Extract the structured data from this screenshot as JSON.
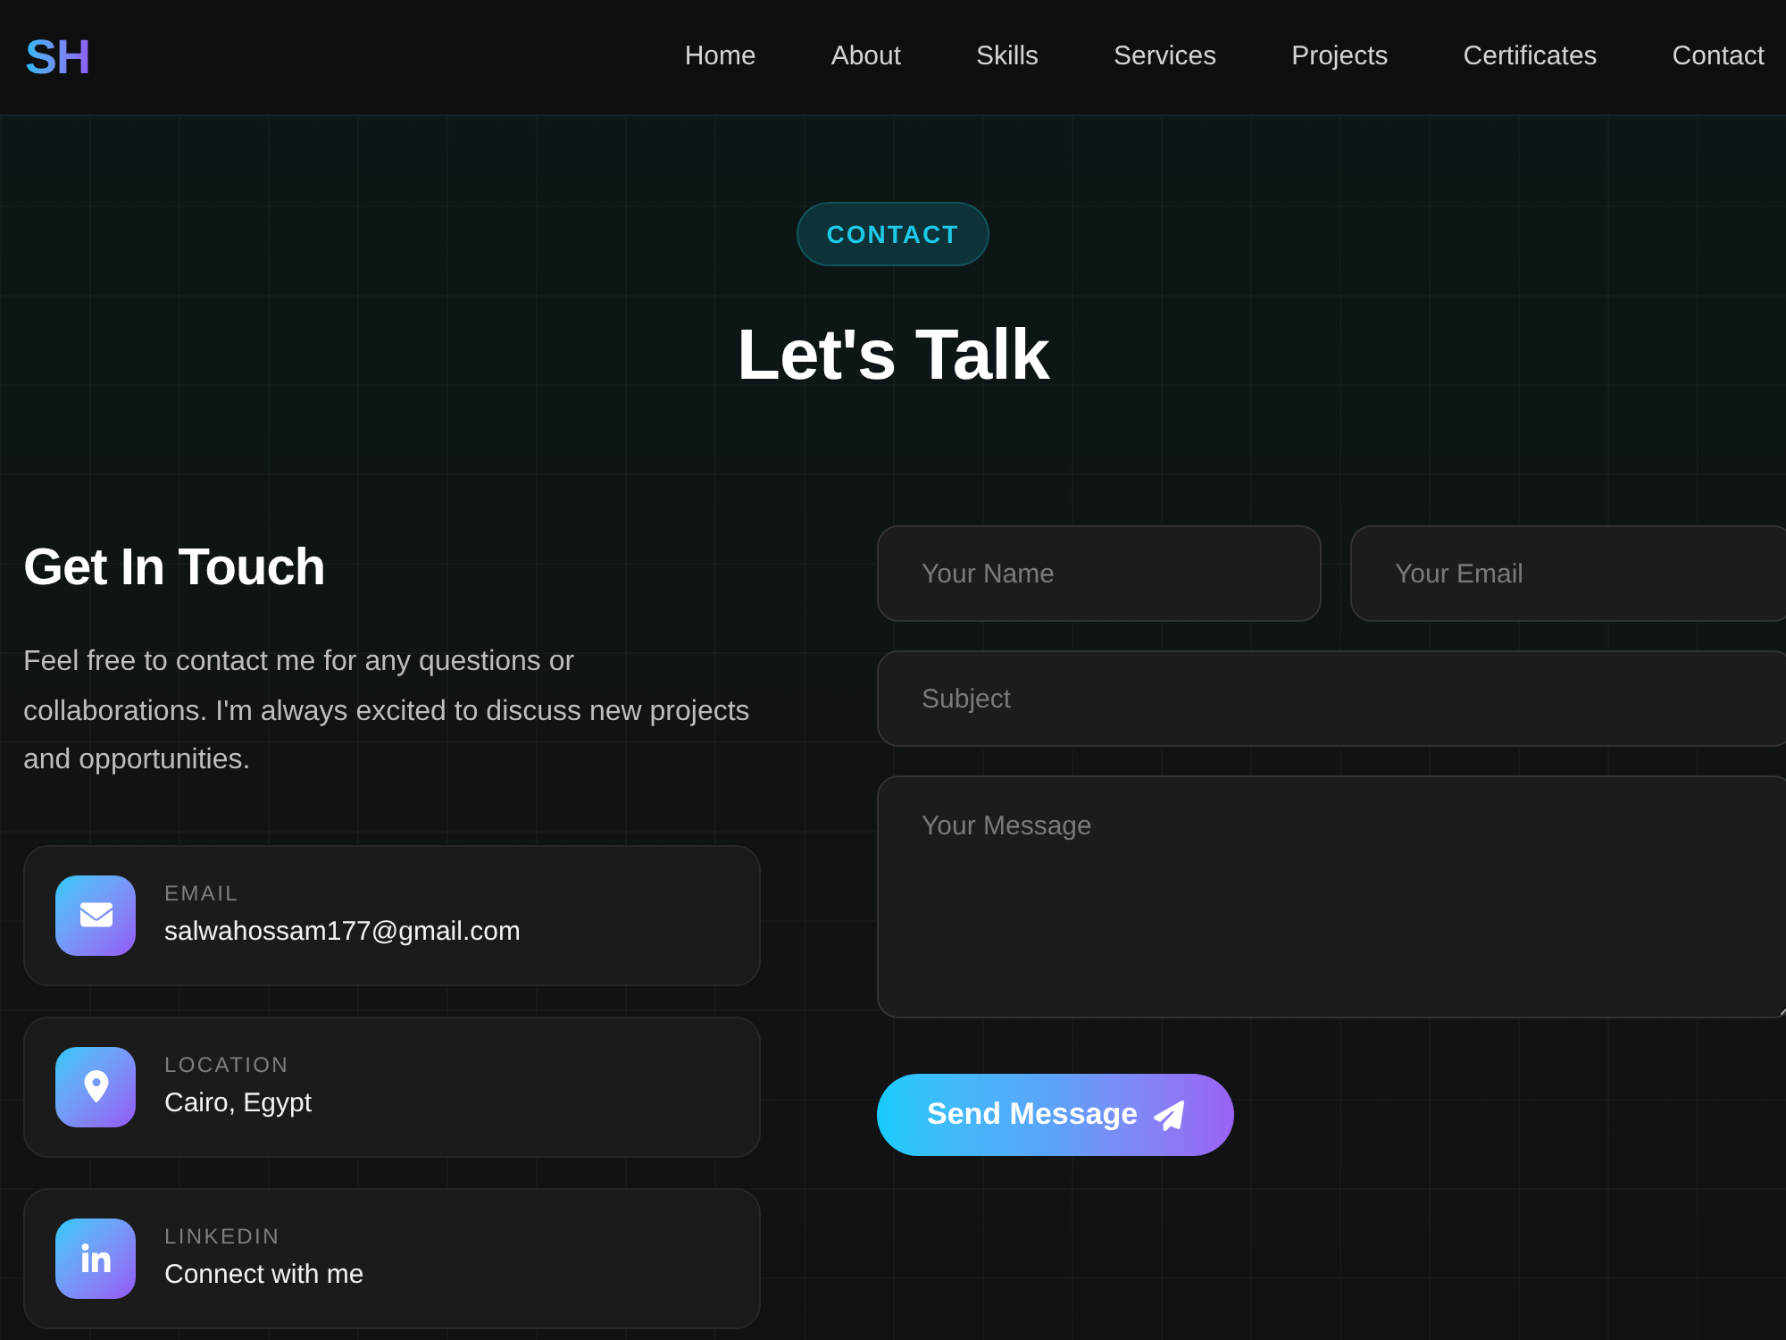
{
  "header": {
    "logo": "SH",
    "nav": [
      "Home",
      "About",
      "Skills",
      "Services",
      "Projects",
      "Certificates",
      "Contact"
    ]
  },
  "section": {
    "badge": "CONTACT",
    "title": "Let's Talk"
  },
  "info": {
    "heading": "Get In Touch",
    "text": "Feel free to contact me for any questions or collaborations. I'm always excited to discuss new projects and opportunities.",
    "items": [
      {
        "kind": "email",
        "label": "EMAIL",
        "value": "salwahossam177@gmail.com"
      },
      {
        "kind": "location",
        "label": "LOCATION",
        "value": "Cairo, Egypt"
      },
      {
        "kind": "linkedin",
        "label": "LINKEDIN",
        "value": "Connect with me"
      }
    ]
  },
  "form": {
    "rows": [
      [
        {
          "kind": "input",
          "placeholder": "Your Name"
        },
        {
          "kind": "input",
          "placeholder": "Your Email"
        }
      ],
      [
        {
          "kind": "input",
          "placeholder": "Subject"
        }
      ],
      [
        {
          "kind": "textarea",
          "placeholder": "Your Message"
        }
      ]
    ],
    "submit": "Send Message"
  }
}
